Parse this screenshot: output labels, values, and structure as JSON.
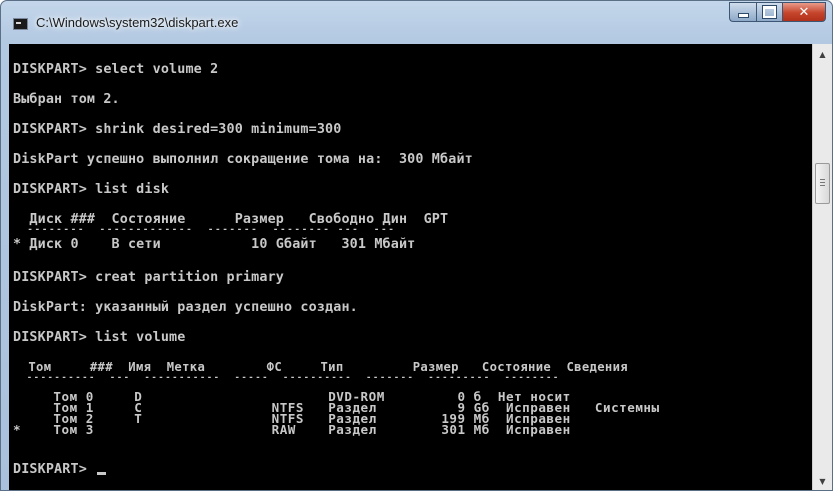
{
  "window": {
    "title": "C:\\Windows\\system32\\diskpart.exe",
    "minimize_glyph": "",
    "maximize_glyph": "",
    "close_glyph": "✕"
  },
  "console": {
    "lines": [
      "DISKPART> select volume 2",
      "Выбран том 2.",
      "DISKPART> shrink desired=300 minimum=300",
      "DiskPart успешно выполнил сокращение тома на:  300 Мбайт",
      "DISKPART> list disk",
      "  Диск ###  Состояние      Размер   Свободно Дин  GPT",
      "  --------  -------------  -------  -------- ---  ---",
      "* Диск 0    В сети           10 Gбайт   301 Мбайт",
      "DISKPART> creat partition primary",
      "DiskPart: указанный раздел успешно создан.",
      "DISKPART> list volume",
      "  Том     ###  Имя  Метка        ФС     Тип         Размер   Состояние  Сведения",
      "  ----------  ---  -----------  -----  ----------  -------  ---------  --------",
      "     Том 0     D                       DVD-ROM         0 б  Нет носит",
      "     Том 1     C                NTFS   Раздел          9 Gб  Исправен   Системны",
      "     Том 2     T                NTFS   Раздел        199 Мб  Исправен",
      "*    Том 3                      RAW    Раздел        301 Мб  Исправен",
      "DISKPART> "
    ]
  },
  "scrollbar": {
    "up_glyph": "▲",
    "down_glyph": "▼",
    "position_fraction": 0.27
  }
}
